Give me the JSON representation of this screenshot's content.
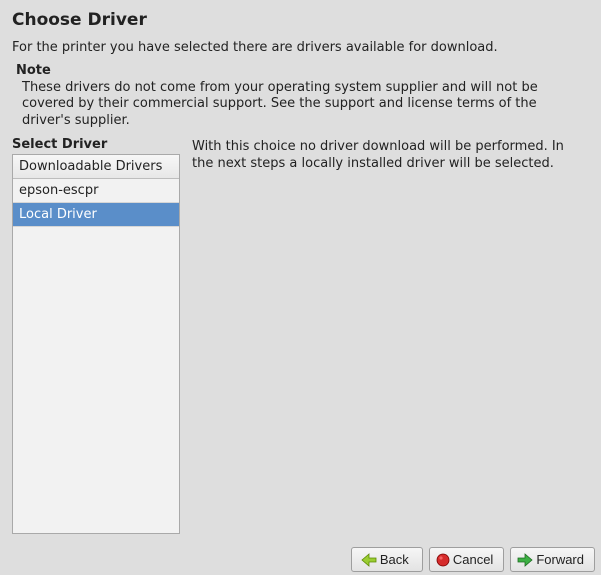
{
  "title": "Choose Driver",
  "intro": "For the printer you have selected there are drivers available for download.",
  "note": {
    "heading": "Note",
    "text": "These drivers do not come from your operating system supplier and will not be covered by their commercial support.  See the support and license terms of the driver's supplier."
  },
  "select": {
    "label": "Select Driver",
    "column_header": "Downloadable Drivers",
    "items": [
      {
        "label": "epson-escpr",
        "selected": false
      },
      {
        "label": "Local Driver",
        "selected": true
      }
    ]
  },
  "description": "With this choice no driver download will be performed. In the next steps a locally installed driver will be selected.",
  "buttons": {
    "back": "Back",
    "cancel": "Cancel",
    "forward": "Forward"
  }
}
